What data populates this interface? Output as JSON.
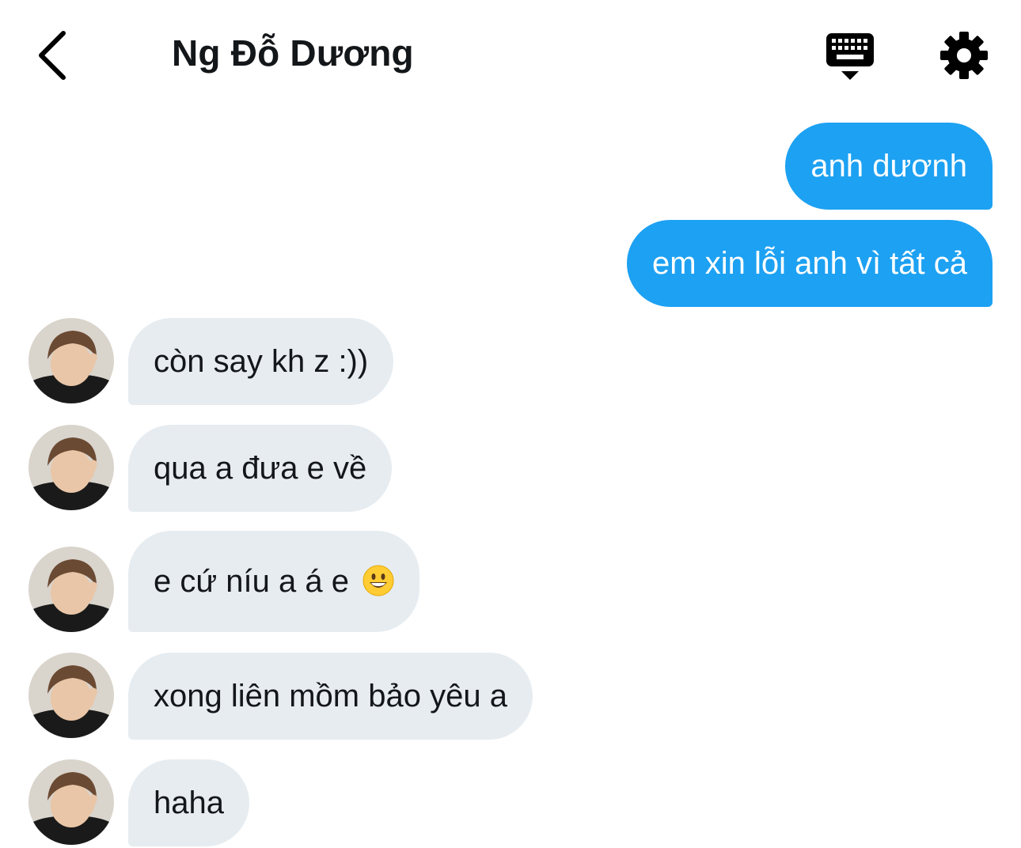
{
  "header": {
    "contact_name": "Ng Đỗ Dương",
    "back_icon": "chevron-left-icon",
    "keyboard_icon": "keyboard-icon",
    "settings_icon": "gear-icon"
  },
  "colors": {
    "sent_bubble": "#1da1f2",
    "received_bubble": "#e6ecf0",
    "text": "#14171a"
  },
  "messages": {
    "sent": [
      {
        "text": "anh dươnh"
      },
      {
        "text": "em xin lỗi anh vì tất cả"
      }
    ],
    "received": [
      {
        "text": "còn say kh z :))"
      },
      {
        "text": "qua a đưa e về"
      },
      {
        "text": "e cứ níu a á e",
        "emoji": "grinning-face-emoji"
      },
      {
        "text": "xong liên mồm bảo yêu a"
      },
      {
        "text": "haha"
      }
    ]
  }
}
